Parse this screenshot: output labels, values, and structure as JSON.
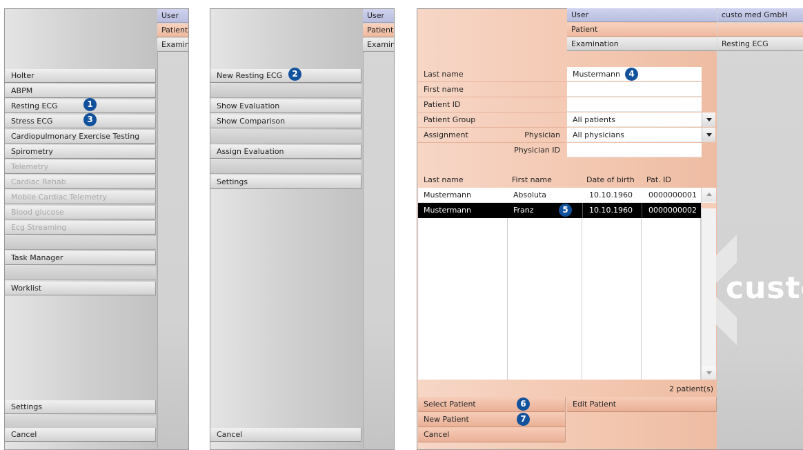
{
  "tabs": {
    "user": "User",
    "patient": "Patient",
    "examination": "Examination",
    "examination_short": "Examin"
  },
  "colors": {
    "badge": "#12529c",
    "user_tab": "#c4c8e8",
    "patient_tab": "#f3c2aa",
    "selected_row": "#000000"
  },
  "main_menu": {
    "items": [
      {
        "label": "Holter",
        "enabled": true
      },
      {
        "label": "ABPM",
        "enabled": true
      },
      {
        "label": "Resting ECG",
        "enabled": true
      },
      {
        "label": "Stress ECG",
        "enabled": true
      },
      {
        "label": "Cardiopulmonary Exercise Testing",
        "enabled": true
      },
      {
        "label": "Spirometry",
        "enabled": true
      },
      {
        "label": "Telemetry",
        "enabled": false
      },
      {
        "label": "Cardiac Rehab",
        "enabled": false
      },
      {
        "label": "Mobile Cardiac Telemetry",
        "enabled": false
      },
      {
        "label": "Blood glucose",
        "enabled": false
      },
      {
        "label": "Ecg Streaming",
        "enabled": false
      }
    ],
    "task_manager": "Task Manager",
    "worklist": "Worklist",
    "settings": "Settings",
    "cancel": "Cancel"
  },
  "ecg_menu": {
    "new_resting_ecg": "New Resting ECG",
    "show_evaluation": "Show Evaluation",
    "show_comparison": "Show Comparison",
    "assign_evaluation": "Assign Evaluation",
    "settings": "Settings",
    "cancel": "Cancel"
  },
  "patient_panel": {
    "header": {
      "company": "custo med GmbH",
      "exam_value": "Resting ECG"
    },
    "search": {
      "last_name_label": "Last name",
      "last_name_value": "Mustermann",
      "first_name_label": "First name",
      "patient_id_label": "Patient ID",
      "patient_group_label": "Patient Group",
      "patient_group_value": "All patients",
      "assignment_label": "Assignment",
      "physician_label": "Physician",
      "physician_value": "All physicians",
      "physician_id_label": "Physician ID"
    },
    "table": {
      "columns": [
        "Last name",
        "First name",
        "Date of birth",
        "Pat. ID"
      ],
      "rows": [
        {
          "last_name": "Mustermann",
          "first_name": "Absoluta",
          "dob": "10.10.1960",
          "pat_id": "0000000001",
          "selected": false
        },
        {
          "last_name": "Mustermann",
          "first_name": "Franz",
          "dob": "10.10.1960",
          "pat_id": "0000000002",
          "selected": true
        }
      ],
      "count": "2 patient(s)"
    },
    "buttons": {
      "select_patient": "Select Patient",
      "edit_patient": "Edit Patient",
      "new_patient": "New Patient",
      "cancel": "Cancel"
    },
    "logo_text": "custo"
  },
  "badges": [
    "1",
    "2",
    "3",
    "4",
    "5",
    "6",
    "7"
  ]
}
